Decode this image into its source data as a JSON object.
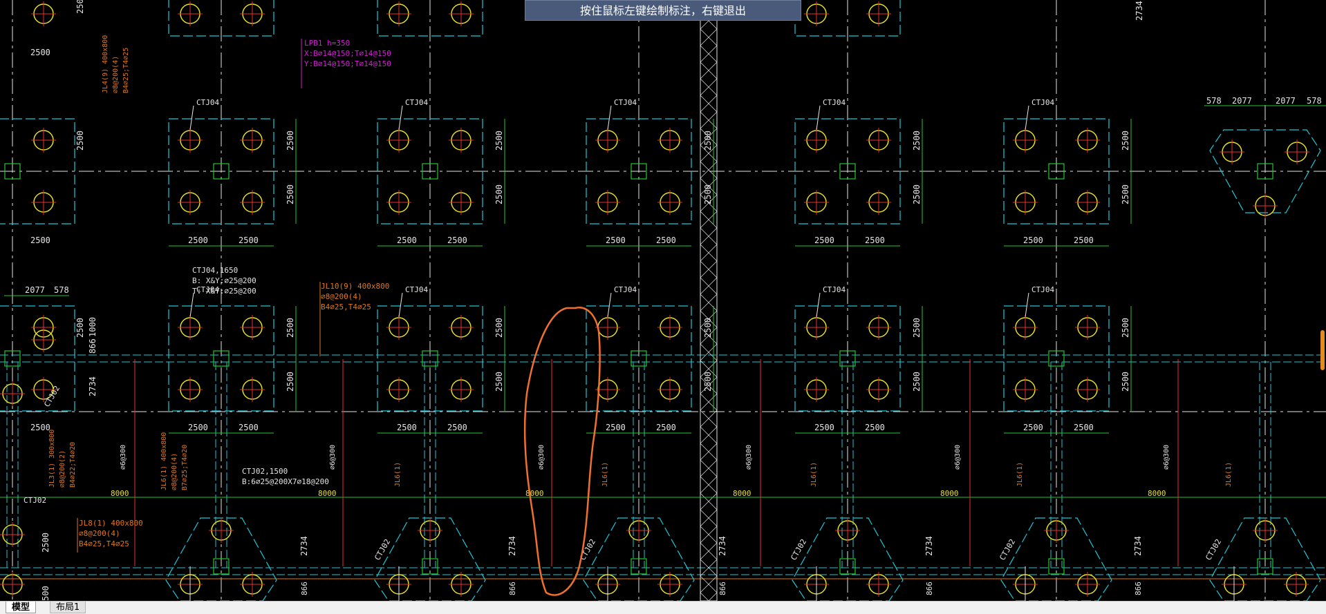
{
  "hint": {
    "text": "按住鼠标左键绘制标注，右键退出"
  },
  "tabs": [
    {
      "label": "模型",
      "active": true
    },
    {
      "label": "布局1",
      "active": false
    }
  ],
  "labels": {
    "cap": "CTJ04",
    "cap2": "CTJ02",
    "dim2500": "2500",
    "dim2077": "2077",
    "dim578": "578",
    "dim2734": "2734",
    "dim8000": "8000",
    "dim866": "866",
    "dim1000": "1000",
    "dim500": "500",
    "lpb": "LPB1 h=350",
    "lpb_x": "X:B⌀14@150;T⌀14@150",
    "lpb_y": "Y:B⌀14@150;T⌀14@150",
    "jl4": "JL4(9) 400x800",
    "jl4_b": "⌀8@200(4)",
    "jl4_c": "B4⌀25;T4⌀25",
    "ctj04h": "CTJ04,1650",
    "ctj04h_b": "B: X&Y:⌀25@200",
    "ctj04h_t": "T: X&Y:⌀25@200",
    "jl10": "JL10(9) 400x800",
    "jl10_b": "⌀8@200(4)",
    "jl10_c": "B4⌀25,T4⌀25",
    "jl3": "JL3(1) 300x800",
    "jl3_b": "⌀8@200(2)",
    "jl3_c": "B4⌀22;T4⌀20",
    "jl6": "JL6(1) 400x800",
    "jl6_b": "⌀8@200(4)",
    "jl6_c": "B7⌀25;T4⌀20",
    "ctj02h": "CTJ02,1500",
    "ctj02h_b": "B:6⌀25@200X7⌀18@200",
    "jl8": "JL8(1) 400x800",
    "jl8_b": "⌀8@200(4)",
    "jl8_c": "B4⌀25,T4⌀25",
    "ve": "⌀6@300",
    "jl6s": "JL6(1)"
  },
  "colors": {
    "cyan": "#1ec8d8",
    "green": "#22c82a",
    "yellow": "#e8e020",
    "red": "#e8302a",
    "white": "#e6e6e6",
    "orange": "#e07818",
    "magenta": "#d020d0",
    "sketch": "#f07030"
  }
}
